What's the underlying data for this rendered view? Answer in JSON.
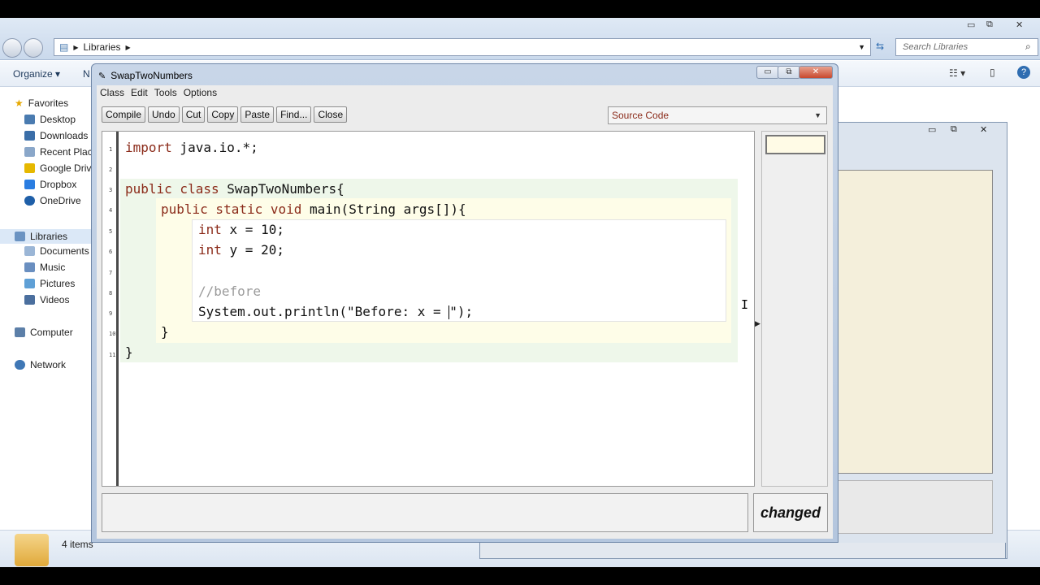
{
  "explorer": {
    "address": [
      "Libraries"
    ],
    "search_placeholder": "Search Libraries",
    "toolbar": {
      "organize": "Organize ▾",
      "next": "N"
    },
    "sidebar": {
      "favorites": "Favorites",
      "favorites_items": [
        "Desktop",
        "Downloads",
        "Recent Place",
        "Google Drive",
        "Dropbox",
        "OneDrive"
      ],
      "libraries": "Libraries",
      "libraries_items": [
        "Documents",
        "Music",
        "Pictures",
        "Videos"
      ],
      "computer": "Computer",
      "network": "Network"
    },
    "status": "4 items"
  },
  "editor": {
    "title": "SwapTwoNumbers",
    "menu": [
      "Class",
      "Edit",
      "Tools",
      "Options"
    ],
    "toolbar": [
      "Compile",
      "Undo",
      "Cut",
      "Copy",
      "Paste",
      "Find...",
      "Close"
    ],
    "view_select": "Source Code",
    "line_numbers": [
      "1",
      "2",
      "3",
      "4",
      "5",
      "6",
      "7",
      "8",
      "9",
      "10",
      "11"
    ],
    "code": {
      "l1_kw": "import",
      "l1_rest": " java.io.*;",
      "l3_kw": "public class",
      "l3_rest": " SwapTwoNumbers{",
      "l4_kw": "public static void",
      "l4_rest": " main(String args[]){",
      "l5_kw": "int",
      "l5_rest": " x = 10;",
      "l6_kw": "int",
      "l6_rest": " y = 20;",
      "l8_comment": "//before",
      "l9_a": "System.out.println(\"Before: x = ",
      "l9_b": "\");",
      "l10": "}",
      "l11": "}"
    },
    "status": "changed"
  },
  "colors": {
    "keyword": "#8b2b1a",
    "comment": "#9a9a9a",
    "class_scope": "#eef7ea",
    "method_scope": "#fefde8"
  }
}
